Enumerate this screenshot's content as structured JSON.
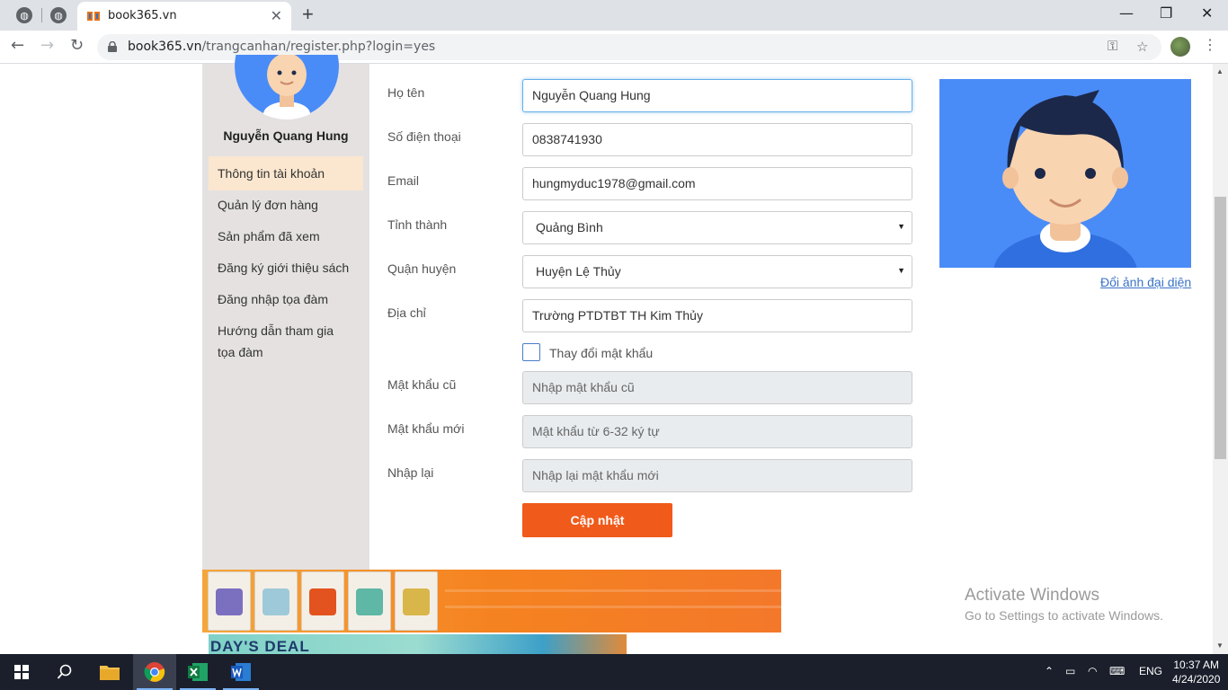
{
  "browser": {
    "tab_title": "book365.vn",
    "url_host": "book365.vn",
    "url_path": "/trangcanhan/register.php?login=yes"
  },
  "sidebar": {
    "user_name": "Nguyễn Quang Hung",
    "items": [
      {
        "label": "Thông tin tài khoản",
        "active": true
      },
      {
        "label": "Quản lý đơn hàng"
      },
      {
        "label": "Sản phẩm đã xem"
      },
      {
        "label": "Đăng ký giới thiệu sách"
      },
      {
        "label": "Đăng nhập tọa đàm"
      },
      {
        "label": "Hướng dẫn tham gia tọa đàm"
      }
    ]
  },
  "form": {
    "fullname_label": "Họ tên",
    "fullname_value": "Nguyễn Quang Hung",
    "phone_label": "Số điện thoại",
    "phone_value": "0838741930",
    "email_label": "Email",
    "email_value": "hungmyduc1978@gmail.com",
    "province_label": "Tỉnh thành",
    "province_value": "Quảng Bình",
    "district_label": "Quận huyện",
    "district_value": "Huyện Lệ Thủy",
    "address_label": "Địa chỉ",
    "address_value": "Trường PTDTBT TH Kim Thủy",
    "change_password_label": "Thay đổi mật khẩu",
    "old_password_label": "Mật khẩu cũ",
    "old_password_placeholder": "Nhập mật khẩu cũ",
    "new_password_label": "Mật khẩu mới",
    "new_password_placeholder": "Mật khẩu từ 6-32 ký tự",
    "confirm_password_label": "Nhập lại",
    "confirm_password_placeholder": "Nhập lại mật khẩu mới",
    "submit_label": "Cập nhật"
  },
  "avatar": {
    "change_label": "Đổi ảnh đại diện"
  },
  "banner2": {
    "text": "DAY'S DEAL"
  },
  "watermark": {
    "title": "Activate Windows",
    "subtitle": "Go to Settings to activate Windows."
  },
  "taskbar": {
    "language": "ENG",
    "time": "10:37 AM",
    "date": "4/24/2020"
  }
}
